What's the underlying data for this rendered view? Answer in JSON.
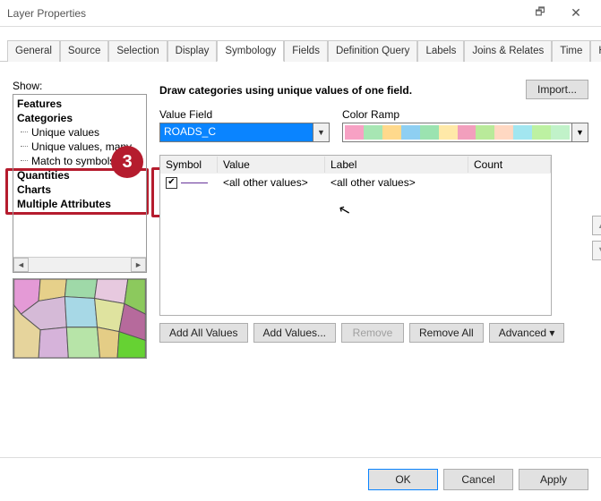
{
  "window": {
    "title": "Layer Properties"
  },
  "tabs": {
    "items": [
      "General",
      "Source",
      "Selection",
      "Display",
      "Symbology",
      "Fields",
      "Definition Query",
      "Labels",
      "Joins & Relates",
      "Time",
      "HTML Popup"
    ],
    "active_index": 4
  },
  "step_badge": "3",
  "show_label": "Show:",
  "tree": {
    "items": [
      {
        "label": "Features",
        "bold": true
      },
      {
        "label": "Categories",
        "bold": true
      },
      {
        "label": "Unique values",
        "bold": false,
        "sub": true
      },
      {
        "label": "Unique values, many",
        "bold": false,
        "sub": true
      },
      {
        "label": "Match to symbols in a",
        "bold": false,
        "sub": true
      },
      {
        "label": "Quantities",
        "bold": true
      },
      {
        "label": "Charts",
        "bold": true
      },
      {
        "label": "Multiple Attributes",
        "bold": true
      }
    ]
  },
  "description": "Draw categories using unique values of one field.",
  "buttons": {
    "import": "Import...",
    "add_all": "Add All Values",
    "add_values": "Add Values...",
    "remove": "Remove",
    "remove_all": "Remove All",
    "advanced": "Advanced  ▾",
    "ok": "OK",
    "cancel": "Cancel",
    "apply": "Apply"
  },
  "value_field": {
    "label": "Value Field",
    "value": "ROADS_C"
  },
  "color_ramp": {
    "label": "Color Ramp",
    "colors": [
      "#f7a1c4",
      "#a7e6b3",
      "#ffd98c",
      "#8ecff2",
      "#9be3b0",
      "#ffe9a8",
      "#f29fbd",
      "#b9ea9a",
      "#ffd8c2",
      "#a2e6f0",
      "#bdf1a2",
      "#c1f2c9"
    ]
  },
  "grid": {
    "headers": {
      "symbol": "Symbol",
      "value": "Value",
      "label": "Label",
      "count": "Count"
    },
    "rows": [
      {
        "checked": true,
        "value": "<all other values>",
        "label": "<all other values>",
        "count": ""
      }
    ]
  }
}
